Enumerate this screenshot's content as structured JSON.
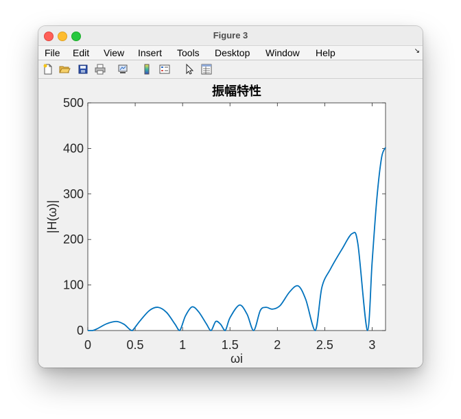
{
  "window": {
    "title": "Figure 3"
  },
  "menu": {
    "items": [
      "File",
      "Edit",
      "View",
      "Insert",
      "Tools",
      "Desktop",
      "Window",
      "Help"
    ]
  },
  "toolbar": {
    "icons": [
      "new-figure-icon",
      "open-file-icon",
      "save-icon",
      "print-icon",
      "link-plot-icon",
      "colorbar-icon",
      "legend-icon",
      "edit-plot-icon",
      "property-inspector-icon"
    ]
  },
  "chart_data": {
    "type": "line",
    "title": "振幅特性",
    "xlabel": "ωi",
    "ylabel": "|H(ω)|",
    "xlim": [
      0,
      3.14159
    ],
    "ylim": [
      0,
      500
    ],
    "xticks": [
      "0",
      "0.5",
      "1",
      "1.5",
      "2",
      "2.5",
      "3"
    ],
    "yticks": [
      "0",
      "100",
      "200",
      "300",
      "400",
      "500"
    ],
    "grid": false,
    "color": "#0072bd",
    "series": [
      {
        "x": [
          0,
          0.05,
          0.1,
          0.2,
          0.3,
          0.38,
          0.44,
          0.47,
          0.55,
          0.65,
          0.74,
          0.83,
          0.92,
          0.97,
          1.03,
          1.1,
          1.17,
          1.25,
          1.3,
          1.35,
          1.4,
          1.45,
          1.5,
          1.6,
          1.68,
          1.75,
          1.82,
          1.88,
          1.95,
          2.03,
          2.13,
          2.22,
          2.3,
          2.4,
          2.47,
          2.56,
          2.68,
          2.79,
          2.85,
          2.95,
          3.0,
          3.05,
          3.1,
          3.1416
        ],
        "y": [
          0,
          0,
          4,
          15,
          20,
          14,
          3,
          0,
          21,
          44,
          51,
          40,
          14,
          0,
          32,
          52,
          41,
          15,
          0,
          20,
          14,
          0,
          28,
          56,
          36,
          0,
          44,
          51,
          47,
          55,
          85,
          98,
          68,
          0,
          95,
          135,
          178,
          213,
          190,
          0,
          150,
          290,
          380,
          402
        ]
      }
    ]
  }
}
